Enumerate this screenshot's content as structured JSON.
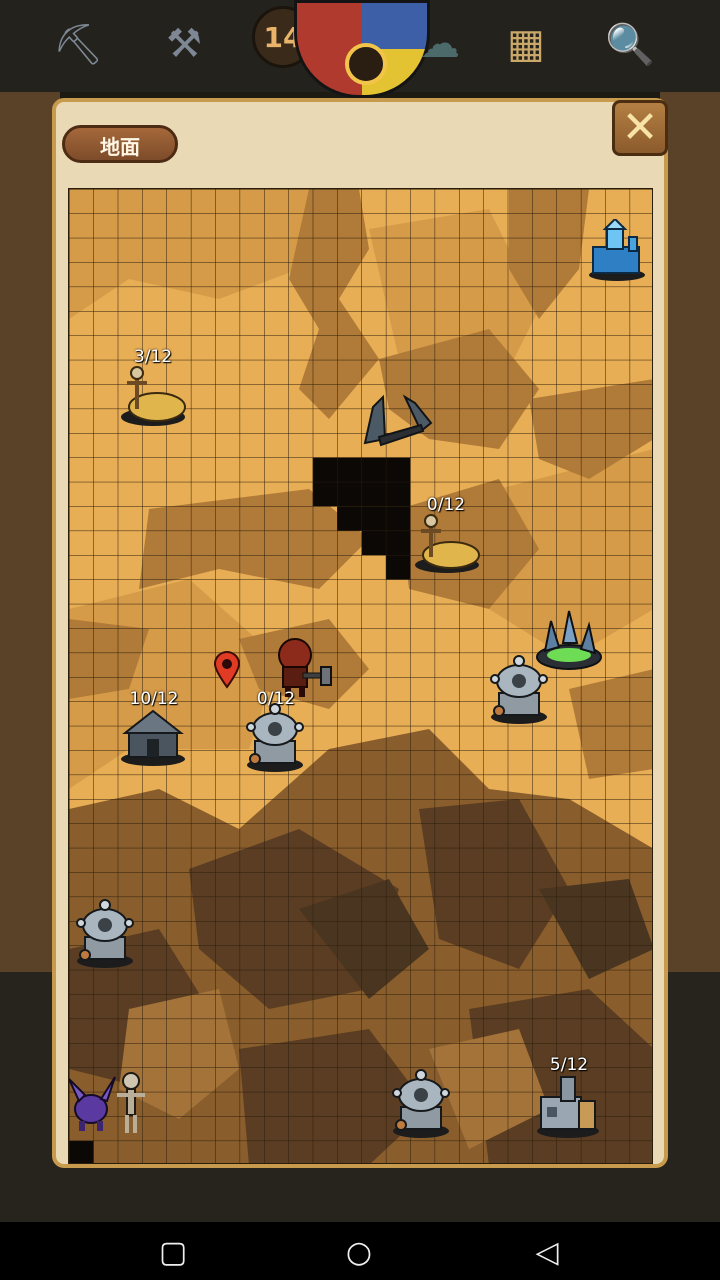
{
  "header": {
    "level_badge": "14",
    "icons": [
      "pickaxe-icon",
      "anvil-icon",
      "day-night-clock-icon",
      "rain-cloud-icon",
      "map-scroll-icon",
      "magnifier-icon"
    ]
  },
  "dialog": {
    "title": "地面",
    "close_icon": "close-x-icon"
  },
  "map": {
    "resource_counters": [
      {
        "id": "scarecrow-nw",
        "text": "3/12"
      },
      {
        "id": "scarecrow-center",
        "text": "0/12"
      },
      {
        "id": "house-w",
        "text": "10/12"
      },
      {
        "id": "tower-w",
        "text": "0/12"
      },
      {
        "id": "factory-se",
        "text": "5/12"
      }
    ],
    "objects": [
      "blue-machine-icon",
      "stone-arch-icon",
      "hay-scarecrow-icon",
      "crystal-pool-icon",
      "mech-tower-icon",
      "player-marker-icon",
      "warrior-hero-icon",
      "wood-house-icon",
      "purple-crab-monster-icon",
      "skeleton-icon",
      "factory-building-icon"
    ]
  },
  "colors": {
    "light_sand": "#e8ae55",
    "mid_sand": "#c98e3f",
    "dark_sand": "#8a5e2c",
    "deep_shadow": "#4a3520",
    "grid_line": "#2a1d0c",
    "marker": "#e13b25"
  },
  "navbar": {
    "icons": [
      "recent-apps-icon",
      "home-icon",
      "back-icon"
    ]
  }
}
